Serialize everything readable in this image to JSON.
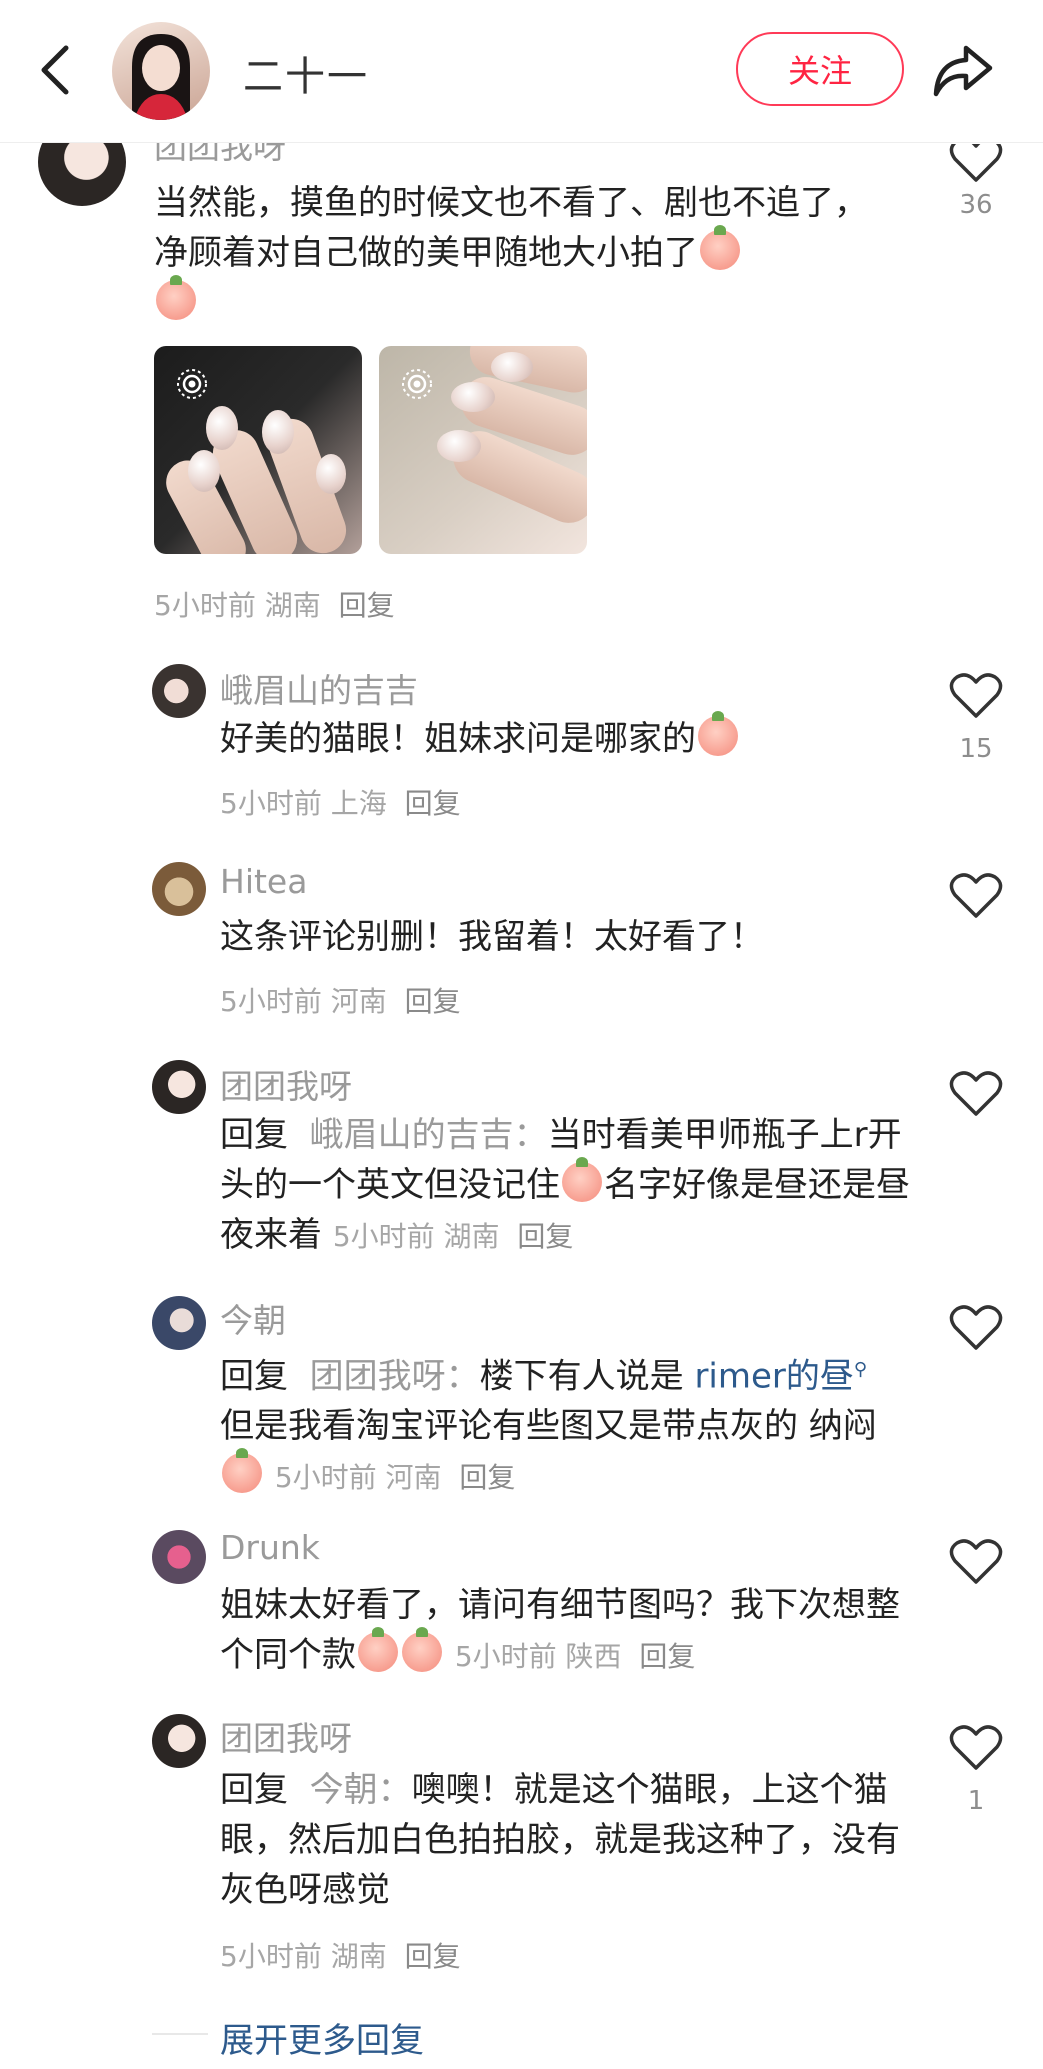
{
  "header": {
    "name": "二十一",
    "follow_label": "关注"
  },
  "top_comment": {
    "username": "团团我呀",
    "text": "当然能，摸鱼的时候文也不看了、剧也不追了，净顾着对自己做的美甲随地大小拍了",
    "time": "5小时前",
    "location": "湖南",
    "reply": "回复",
    "likes": "36"
  },
  "replies": [
    {
      "username": "峨眉山的吉吉",
      "text": "好美的猫眼！姐妹求问是哪家的",
      "time": "5小时前",
      "location": "上海",
      "reply": "回复",
      "likes": "15"
    },
    {
      "username": "Hitea",
      "text": "这条评论别删！我留着！太好看了！",
      "time": "5小时前",
      "location": "河南",
      "reply": "回复",
      "likes": ""
    },
    {
      "username": "团团我呀",
      "reply_prefix": "回复",
      "reply_to": "峨眉山的吉吉：",
      "text_a": "当时看美甲师瓶子上r开头的一个英文但没记住",
      "text_b": "名字好像是昼还是昼夜来着",
      "time": "5小时前",
      "location": "湖南",
      "reply": "回复",
      "likes": ""
    },
    {
      "username": "今朝",
      "reply_prefix": "回复",
      "reply_to": "团团我呀：",
      "text_a": "楼下有人说是",
      "link": "rimer的昼",
      "text_b": "但是我看淘宝评论有些图又是带点灰的 纳闷",
      "time": "5小时前",
      "location": "河南",
      "reply": "回复",
      "likes": ""
    },
    {
      "username": "Drunk",
      "text": "姐妹太好看了，请问有细节图吗？我下次想整个同个款",
      "time": "5小时前",
      "location": "陕西",
      "reply": "回复",
      "likes": ""
    },
    {
      "username": "团团我呀",
      "reply_prefix": "回复",
      "reply_to": "今朝：",
      "text": "噢噢！就是这个猫眼，上这个猫眼，然后加白色拍拍胶，就是我这种了，没有灰色呀感觉",
      "time": "5小时前",
      "location": "湖南",
      "reply": "回复",
      "likes": "1"
    }
  ],
  "expand_label": "展开更多回复",
  "colors": {
    "accent": "#ff2442",
    "link": "#2d5a8c",
    "meta": "#a6a6a6"
  }
}
